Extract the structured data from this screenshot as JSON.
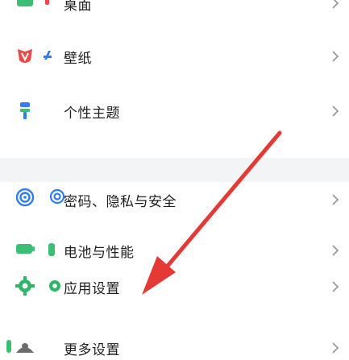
{
  "colors": {
    "accent_green": "#3cbf74",
    "accent_blue": "#2f7cf6",
    "accent_red": "#e94b4b",
    "icon_green": "#2fb565",
    "arrow_red": "#e53935",
    "chevron": "#9a9a9a",
    "section_gap": "#f3f4f6"
  },
  "settings_list": {
    "items": [
      {
        "label": "桌面",
        "icon": "home-icon"
      },
      {
        "label": "壁纸",
        "icon": "wallpaper-icon"
      },
      {
        "label": "个性主题",
        "icon": "theme-icon"
      },
      {
        "label": "密码、隐私与安全",
        "icon": "shield-icon"
      },
      {
        "label": "电池与性能",
        "icon": "battery-icon"
      },
      {
        "label": "应用设置",
        "icon": "gear-icon"
      },
      {
        "label": "更多设置",
        "icon": "more-settings-icon"
      }
    ]
  }
}
